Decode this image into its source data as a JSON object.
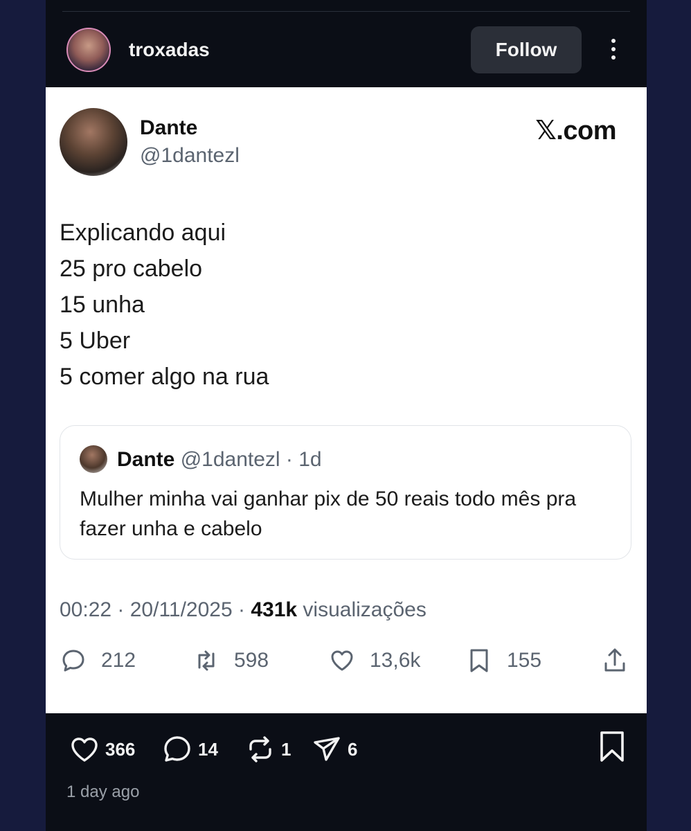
{
  "instagram": {
    "username": "troxadas",
    "follow_label": "Follow",
    "likes": "366",
    "comments": "14",
    "reposts": "1",
    "shares": "6",
    "time_ago": "1 day ago"
  },
  "tweet": {
    "name": "Dante",
    "handle": "@1dantezl",
    "brand": "𝕏.com",
    "lines": [
      "Explicando aqui",
      "25 pro cabelo",
      "15 unha",
      "5 Uber",
      "5 comer algo na rua"
    ],
    "quoted": {
      "name": "Dante",
      "handle_meta": "@1dantezl · 1d",
      "text": "Mulher minha vai ganhar pix de 50 reais todo mês pra fazer unha e cabelo"
    },
    "timestamp": "00:22 · 20/11/2025 · ",
    "views_count": "431k",
    "views_label": " visualizações",
    "replies": "212",
    "retweets": "598",
    "likes": "13,6k",
    "bookmarks": "155"
  }
}
